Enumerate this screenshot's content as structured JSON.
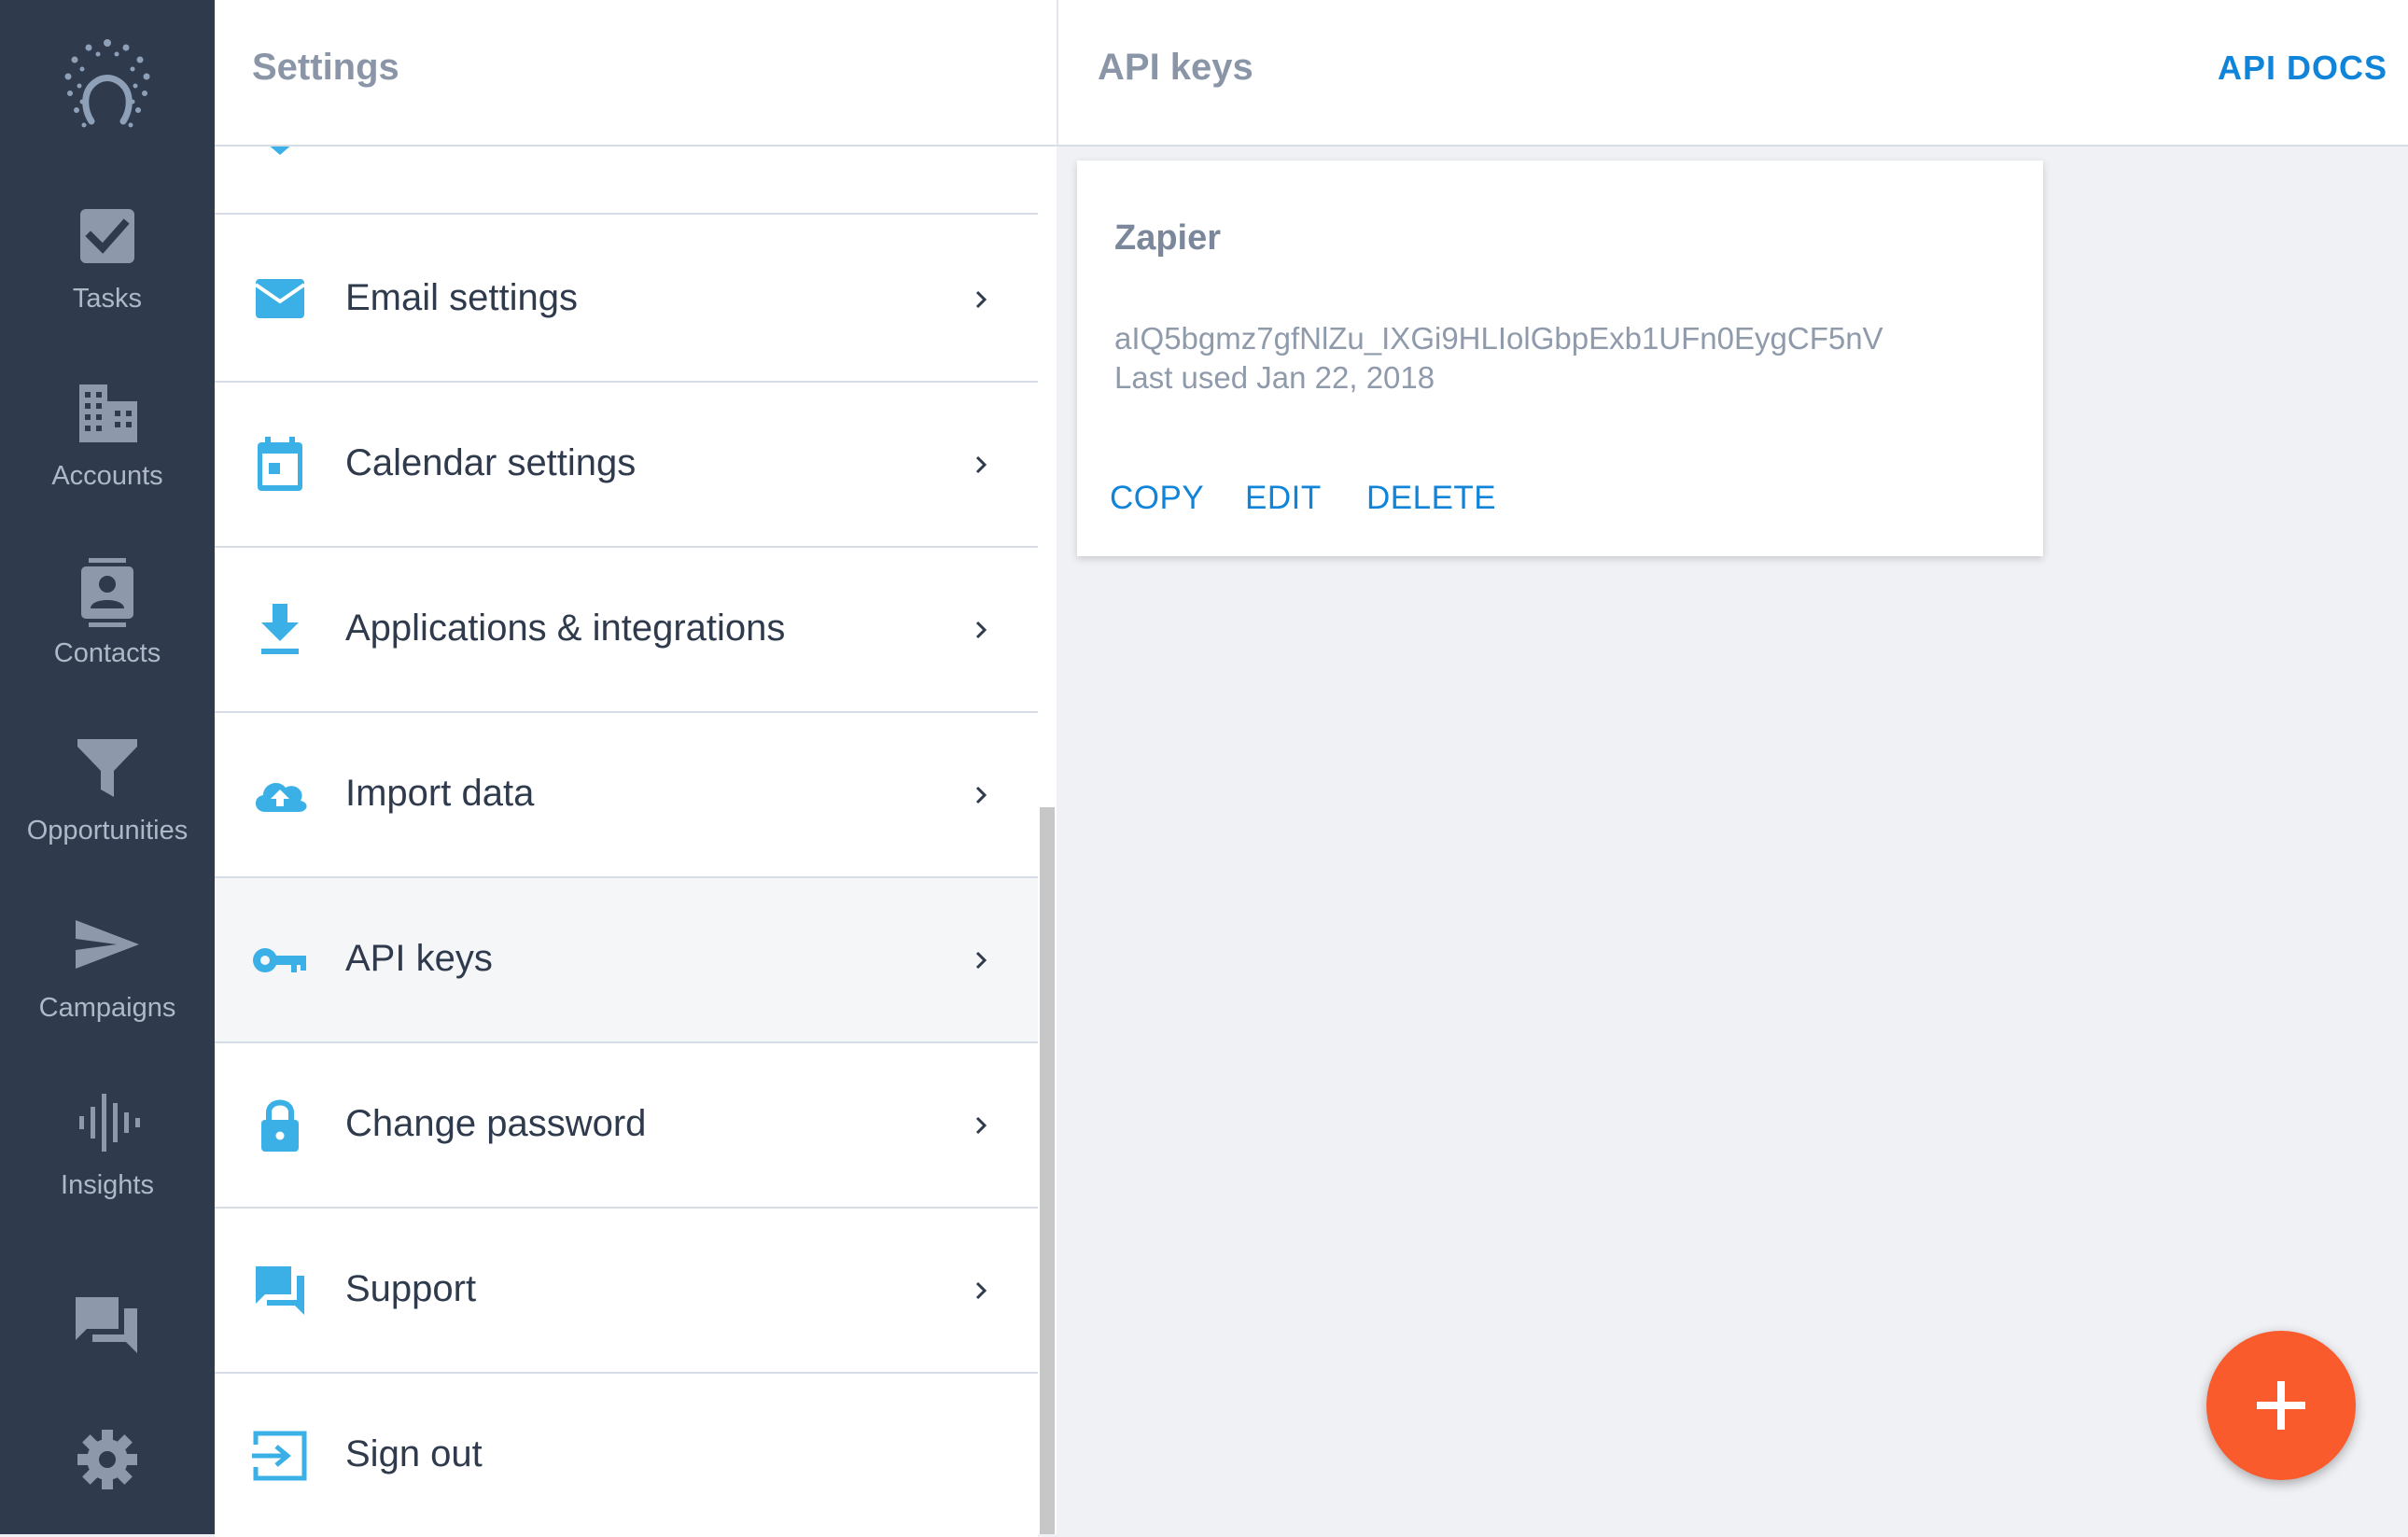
{
  "nav": {
    "items": [
      {
        "label": "Tasks",
        "icon": "checkbox-icon"
      },
      {
        "label": "Accounts",
        "icon": "building-icon"
      },
      {
        "label": "Contacts",
        "icon": "contact-card-icon"
      },
      {
        "label": "Opportunities",
        "icon": "funnel-icon"
      },
      {
        "label": "Campaigns",
        "icon": "send-icon"
      },
      {
        "label": "Insights",
        "icon": "waveform-icon"
      }
    ],
    "extra_icons": [
      "chat-icon",
      "gear-icon"
    ]
  },
  "settings": {
    "title": "Settings",
    "items": [
      {
        "label": "Email settings",
        "icon": "envelope-icon"
      },
      {
        "label": "Calendar settings",
        "icon": "calendar-icon"
      },
      {
        "label": "Applications & integrations",
        "icon": "download-icon"
      },
      {
        "label": "Import data",
        "icon": "cloud-upload-icon"
      },
      {
        "label": "API keys",
        "icon": "key-icon",
        "active": true
      },
      {
        "label": "Change password",
        "icon": "lock-icon"
      },
      {
        "label": "Support",
        "icon": "chat-bubbles-icon"
      },
      {
        "label": "Sign out",
        "icon": "sign-out-icon"
      }
    ]
  },
  "main": {
    "title": "API keys",
    "docs_label": "API DOCS",
    "key": {
      "name": "Zapier",
      "value": "aIQ5bgmz7gfNlZu_IXGi9HLIolGbpExb1UFn0EygCF5nV",
      "last_used": "Last used Jan 22, 2018",
      "actions": {
        "copy": "COPY",
        "edit": "EDIT",
        "delete": "DELETE"
      }
    }
  },
  "fab_label": "+",
  "colors": {
    "nav_bg": "#2f3a4d",
    "accent_blue": "#0f84d8",
    "icon_blue": "#3bb0e6",
    "fab": "#f95b2d"
  }
}
